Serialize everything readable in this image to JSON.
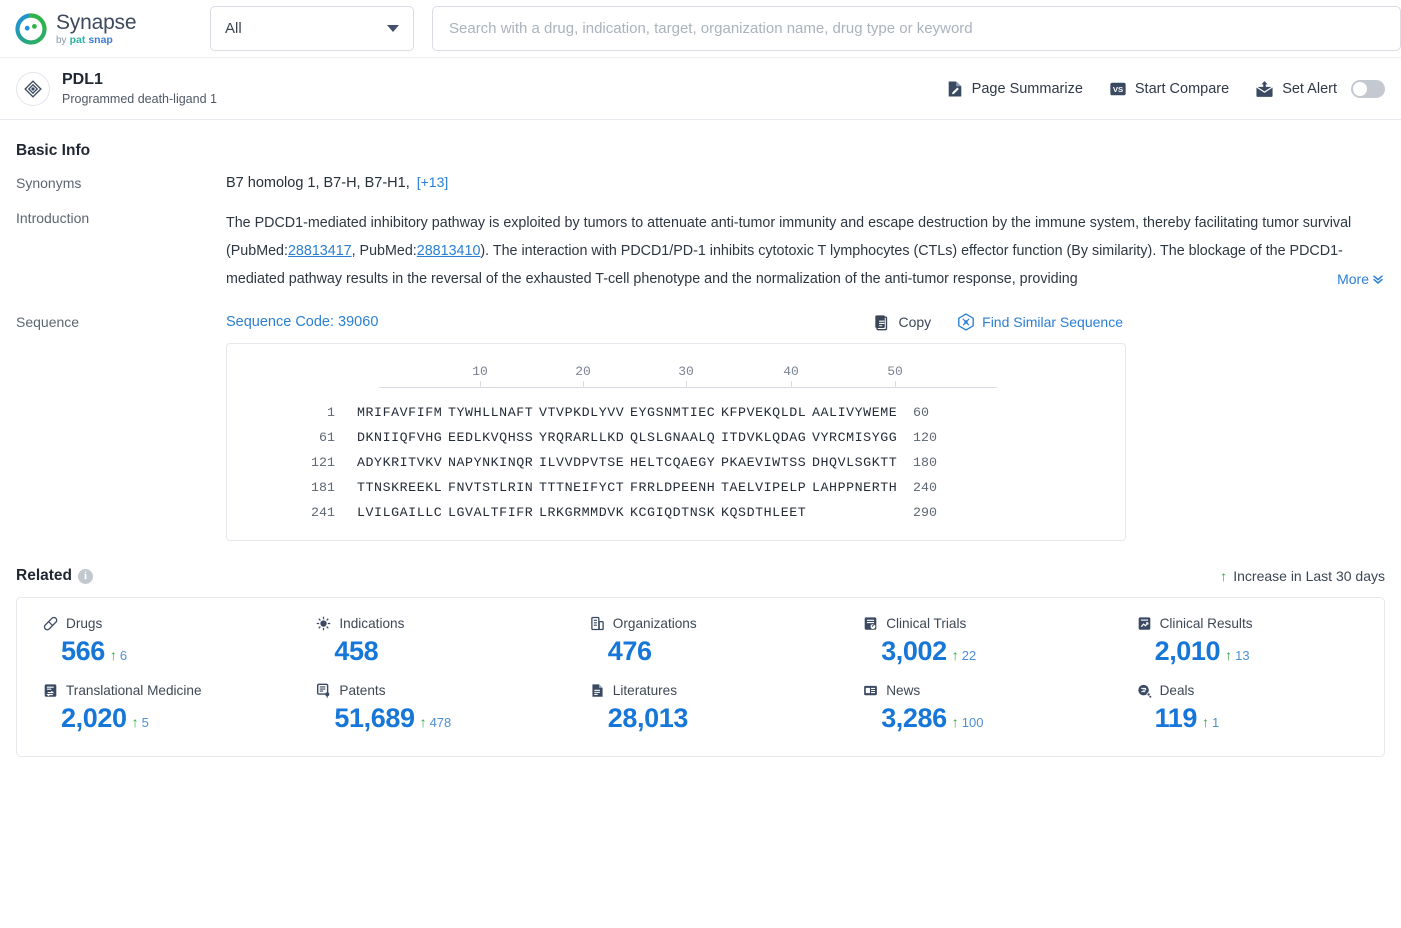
{
  "brand": {
    "name": "Synapse",
    "by": "by",
    "pat": "pat",
    "snap": "snap"
  },
  "search": {
    "scope_label": "All",
    "placeholder": "Search with a drug, indication, target, organization name, drug type or keyword",
    "value": ""
  },
  "target": {
    "icon": "target-diamond-icon",
    "title": "PDL1",
    "subtitle": "Programmed death-ligand 1",
    "actions": [
      {
        "label": "Page Summarize",
        "icon": "page-summarize-icon"
      },
      {
        "label": "Start Compare",
        "icon": "versus-icon"
      },
      {
        "label": "Set Alert",
        "icon": "alert-mail-icon"
      }
    ],
    "alert_enabled": false
  },
  "basic_info": {
    "heading": "Basic Info",
    "synonyms_label": "Synonyms",
    "synonyms": [
      "B7 homolog 1,",
      "B7-H,",
      "B7-H1,"
    ],
    "synonyms_more": "[+13]",
    "introduction_label": "Introduction",
    "introduction": {
      "p1": "The PDCD1-mediated inhibitory pathway is exploited by tumors to attenuate anti-tumor immunity and escape destruction by the immune system, thereby facilitating tumor survival (PubMed:",
      "link1": "28813417",
      "p2": ", PubMed:",
      "link2": "28813410",
      "p3": "). The interaction with PDCD1/PD-1 inhibits cytotoxic T lymphocytes (CTLs) effector function (By similarity). The blockage of the PDCD1-mediated pathway results in the reversal of the exhausted T-cell phenotype and the normalization of the anti-tumor response, providing",
      "more_label": "More"
    },
    "sequence_label": "Sequence",
    "sequence_code": "Sequence Code: 39060",
    "copy_label": "Copy",
    "find_similar_label": "Find Similar Sequence",
    "ruler_ticks": [
      10,
      20,
      30,
      40,
      50
    ],
    "sequence_rows": [
      {
        "start": "1",
        "blocks": [
          "MRIFAVFIFM",
          "TYWHLLNAFT",
          "VTVPKDLYVV",
          "EYGSNMTIEC",
          "KFPVEKQLDL",
          "AALIVYWEME"
        ],
        "end": "60"
      },
      {
        "start": "61",
        "blocks": [
          "DKNIIQFVHG",
          "EEDLKVQHSS",
          "YRQRARLLKD",
          "QLSLGNAALQ",
          "ITDVKLQDAG",
          "VYRCMISYGG"
        ],
        "end": "120"
      },
      {
        "start": "121",
        "blocks": [
          "ADYKRITVKV",
          "NAPYNKINQR",
          "ILVVDPVTSE",
          "HELTCQAEGY",
          "PKAEVIWTSS",
          "DHQVLSGKTT"
        ],
        "end": "180"
      },
      {
        "start": "181",
        "blocks": [
          "TTNSKREEKL",
          "FNVTSTLRIN",
          "TTTNEIFYCT",
          "FRRLDPEENH",
          "TAELVIPELP",
          "LAHPPNERTH"
        ],
        "end": "240"
      },
      {
        "start": "241",
        "blocks": [
          "LVILGAILLC",
          "LGVALTFIFR",
          "LRKGRMMDVK",
          "KCGIQDTNSK",
          "KQSDTHLEET",
          ""
        ],
        "end": "290"
      }
    ]
  },
  "related": {
    "heading": "Related",
    "info_icon": "info-icon",
    "legend": "Increase in Last 30 days",
    "stats": [
      {
        "label": "Drugs",
        "icon": "pill-icon",
        "value": "566",
        "delta": "6"
      },
      {
        "label": "Indications",
        "icon": "virus-icon",
        "value": "458",
        "delta": ""
      },
      {
        "label": "Organizations",
        "icon": "building-icon",
        "value": "476",
        "delta": ""
      },
      {
        "label": "Clinical Trials",
        "icon": "clinical-trial-icon",
        "value": "3,002",
        "delta": "22"
      },
      {
        "label": "Clinical Results",
        "icon": "clinical-result-icon",
        "value": "2,010",
        "delta": "13"
      },
      {
        "label": "Translational Medicine",
        "icon": "translational-icon",
        "value": "2,020",
        "delta": "5"
      },
      {
        "label": "Patents",
        "icon": "patent-icon",
        "value": "51,689",
        "delta": "478"
      },
      {
        "label": "Literatures",
        "icon": "literature-icon",
        "value": "28,013",
        "delta": ""
      },
      {
        "label": "News",
        "icon": "news-icon",
        "value": "3,286",
        "delta": "100"
      },
      {
        "label": "Deals",
        "icon": "deals-icon",
        "value": "119",
        "delta": "1"
      }
    ]
  },
  "colors": {
    "accent_blue": "#1677d8",
    "link_blue": "#2a7fd4",
    "increase_green": "#2aa840",
    "icon_navy": "#3b4a63"
  }
}
